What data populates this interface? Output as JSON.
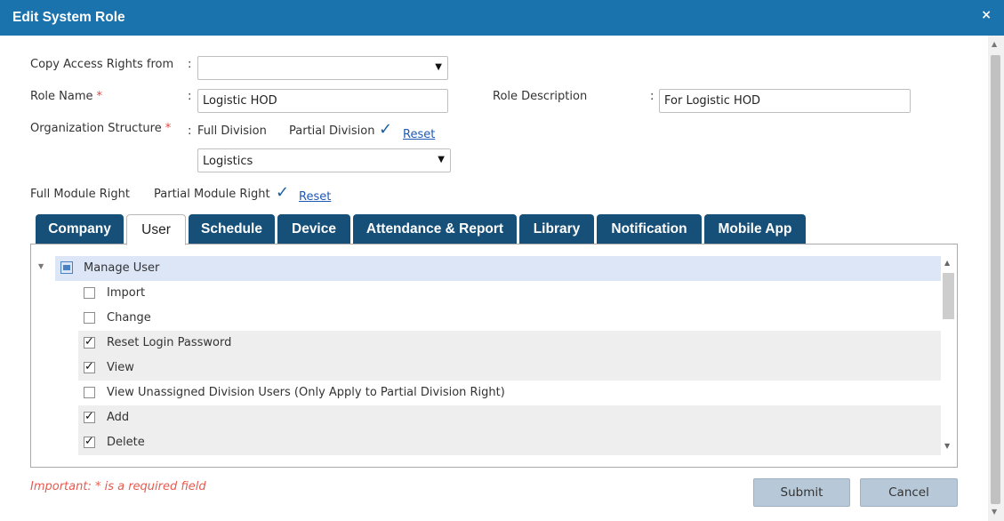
{
  "dialog": {
    "title": "Edit System Role",
    "close_glyph": "×"
  },
  "form": {
    "copy_access": {
      "label": "Copy Access Rights from",
      "value": ""
    },
    "role_name": {
      "label": "Role Name",
      "required_mark": "*",
      "value": "Logistic HOD"
    },
    "role_description": {
      "label": "Role Description",
      "value": "For Logistic HOD"
    },
    "org_structure": {
      "label": "Organization Structure",
      "required_mark": "*",
      "option_full": "Full Division",
      "option_partial": "Partial Division",
      "selected": "Partial Division",
      "reset_label": "Reset",
      "division_value": "Logistics"
    },
    "module_right": {
      "option_full": "Full Module Right",
      "option_partial": "Partial Module Right",
      "selected": "Partial Module Right",
      "reset_label": "Reset"
    },
    "colon": ":",
    "checkmark_glyph": "✓"
  },
  "tabs": [
    {
      "label": "Company",
      "active": false
    },
    {
      "label": "User",
      "active": true
    },
    {
      "label": "Schedule",
      "active": false
    },
    {
      "label": "Device",
      "active": false
    },
    {
      "label": "Attendance & Report",
      "active": false
    },
    {
      "label": "Library",
      "active": false
    },
    {
      "label": "Notification",
      "active": false
    },
    {
      "label": "Mobile App",
      "active": false
    }
  ],
  "tree": {
    "root": {
      "label": "Manage User",
      "icon": "partial-checkbox-icon",
      "toggle_glyph": "▼"
    },
    "items": [
      {
        "label": "Import",
        "checked": false
      },
      {
        "label": "Change",
        "checked": false
      },
      {
        "label": "Reset Login Password",
        "checked": true
      },
      {
        "label": "View",
        "checked": true
      },
      {
        "label": "View Unassigned Division Users (Only Apply to Partial Division Right)",
        "checked": false
      },
      {
        "label": "Add",
        "checked": true
      },
      {
        "label": "Delete",
        "checked": true
      }
    ]
  },
  "footer": {
    "note": "Important: * is a required field",
    "submit_label": "Submit",
    "cancel_label": "Cancel"
  },
  "glyphs": {
    "caret": "▼",
    "up": "▲",
    "down": "▼",
    "check": "✓"
  },
  "colors": {
    "titlebar": "#1a73ad",
    "tab": "#164f78",
    "required": "#e8453c",
    "link": "#1f58b5",
    "button": "#b7c8d8"
  }
}
